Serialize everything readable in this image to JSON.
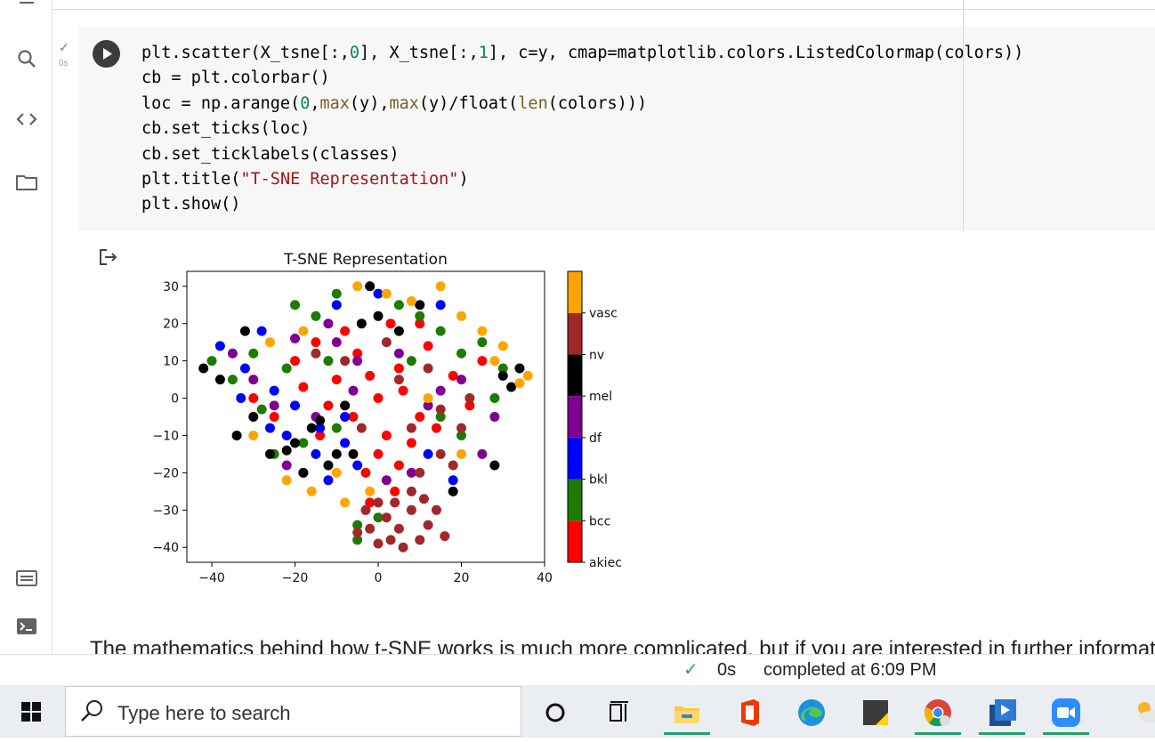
{
  "cell": {
    "run_time": "0s",
    "code_lines": [
      [
        {
          "t": "plt.scatter(X_tsne[:,"
        },
        {
          "t": "0",
          "c": "num"
        },
        {
          "t": "], X_tsne[:,"
        },
        {
          "t": "1",
          "c": "num"
        },
        {
          "t": "], c=y, cmap=matplotlib.colors.ListedColormap(colors))"
        }
      ],
      [
        {
          "t": "cb = plt.colorbar()"
        }
      ],
      [
        {
          "t": "loc = np.arange("
        },
        {
          "t": "0",
          "c": "num"
        },
        {
          "t": ","
        },
        {
          "t": "max",
          "c": "fn"
        },
        {
          "t": "(y),"
        },
        {
          "t": "max",
          "c": "fn"
        },
        {
          "t": "(y)/float("
        },
        {
          "t": "len",
          "c": "fn"
        },
        {
          "t": "(colors)))"
        }
      ],
      [
        {
          "t": "cb.set_ticks(loc)"
        }
      ],
      [
        {
          "t": "cb.set_ticklabels(classes)"
        }
      ],
      [
        {
          "t": "plt.title("
        },
        {
          "t": "\"T-SNE Representation\"",
          "c": "str"
        },
        {
          "t": ")"
        }
      ],
      [
        {
          "t": "plt.show()"
        }
      ]
    ]
  },
  "chart_data": {
    "type": "scatter",
    "title": "T-SNE Representation",
    "xlabel": "",
    "ylabel": "",
    "xlim": [
      -46,
      40
    ],
    "ylim": [
      -44,
      34
    ],
    "x_ticks": [
      -40,
      -20,
      0,
      20,
      40
    ],
    "y_ticks": [
      30,
      20,
      10,
      0,
      -10,
      -20,
      -30,
      -40
    ],
    "colorbar": {
      "classes": [
        "akiec",
        "bcc",
        "bkl",
        "df",
        "mel",
        "nv",
        "vasc"
      ],
      "colors": [
        "#ff0000",
        "#1e7b00",
        "#0000ff",
        "#7f0090",
        "#000000",
        "#a0282a",
        "#ffa500"
      ]
    },
    "series": [
      {
        "class": "akiec",
        "points": [
          [
            -20,
            10
          ],
          [
            -15,
            15
          ],
          [
            -10,
            5
          ],
          [
            -5,
            12
          ],
          [
            0,
            0
          ],
          [
            5,
            8
          ],
          [
            10,
            -5
          ],
          [
            2,
            -10
          ],
          [
            0,
            -15
          ],
          [
            -3,
            -20
          ],
          [
            5,
            -18
          ],
          [
            8,
            -12
          ],
          [
            -12,
            -2
          ],
          [
            -18,
            3
          ],
          [
            -8,
            18
          ],
          [
            3,
            20
          ],
          [
            12,
            14
          ],
          [
            18,
            6
          ],
          [
            22,
            -2
          ],
          [
            -25,
            -5
          ],
          [
            -30,
            0
          ],
          [
            -14,
            -10
          ],
          [
            6,
            2
          ],
          [
            -2,
            6
          ],
          [
            14,
            -8
          ],
          [
            25,
            10
          ],
          [
            -6,
            -5
          ],
          [
            4,
            -25
          ],
          [
            -2,
            -28
          ],
          [
            10,
            20
          ]
        ]
      },
      {
        "class": "bcc",
        "points": [
          [
            -40,
            10
          ],
          [
            -35,
            5
          ],
          [
            -30,
            12
          ],
          [
            -28,
            -3
          ],
          [
            -20,
            25
          ],
          [
            -15,
            22
          ],
          [
            -10,
            28
          ],
          [
            5,
            25
          ],
          [
            10,
            22
          ],
          [
            15,
            18
          ],
          [
            20,
            12
          ],
          [
            25,
            15
          ],
          [
            30,
            8
          ],
          [
            -25,
            -15
          ],
          [
            -18,
            -12
          ],
          [
            -10,
            -8
          ],
          [
            0,
            -32
          ],
          [
            -5,
            -34
          ],
          [
            15,
            -5
          ],
          [
            8,
            10
          ],
          [
            -12,
            10
          ],
          [
            20,
            -10
          ],
          [
            -22,
            8
          ],
          [
            -5,
            -38
          ],
          [
            28,
            0
          ]
        ]
      },
      {
        "class": "bkl",
        "points": [
          [
            -38,
            14
          ],
          [
            -32,
            8
          ],
          [
            -25,
            2
          ],
          [
            -22,
            -10
          ],
          [
            -15,
            -15
          ],
          [
            -8,
            -5
          ],
          [
            -18,
            -20
          ],
          [
            -12,
            -22
          ],
          [
            -5,
            -18
          ],
          [
            -28,
            18
          ],
          [
            -20,
            -2
          ],
          [
            -14,
            -8
          ],
          [
            15,
            25
          ],
          [
            12,
            -15
          ],
          [
            0,
            28
          ],
          [
            -8,
            -12
          ],
          [
            -26,
            -8
          ],
          [
            18,
            -22
          ],
          [
            -33,
            0
          ],
          [
            -10,
            25
          ]
        ]
      },
      {
        "class": "df",
        "points": [
          [
            -35,
            12
          ],
          [
            -25,
            -2
          ],
          [
            -20,
            16
          ],
          [
            -12,
            20
          ],
          [
            -10,
            15
          ],
          [
            -5,
            10
          ],
          [
            5,
            12
          ],
          [
            12,
            -2
          ],
          [
            20,
            5
          ],
          [
            28,
            -5
          ],
          [
            -30,
            5
          ],
          [
            -15,
            -5
          ],
          [
            2,
            -22
          ],
          [
            8,
            -20
          ],
          [
            25,
            -15
          ],
          [
            -6,
            2
          ],
          [
            15,
            2
          ],
          [
            -22,
            -18
          ]
        ]
      },
      {
        "class": "mel",
        "points": [
          [
            -42,
            8
          ],
          [
            -38,
            5
          ],
          [
            -34,
            -10
          ],
          [
            -30,
            -5
          ],
          [
            -26,
            -15
          ],
          [
            -20,
            -12
          ],
          [
            -16,
            -8
          ],
          [
            -12,
            -18
          ],
          [
            -8,
            -2
          ],
          [
            -4,
            20
          ],
          [
            -2,
            30
          ],
          [
            0,
            22
          ],
          [
            5,
            18
          ],
          [
            10,
            25
          ],
          [
            30,
            6
          ],
          [
            32,
            3
          ],
          [
            28,
            -18
          ],
          [
            -6,
            -15
          ],
          [
            -22,
            -14
          ],
          [
            -32,
            18
          ],
          [
            -18,
            -20
          ],
          [
            -10,
            -15
          ],
          [
            18,
            -25
          ],
          [
            34,
            8
          ],
          [
            -14,
            -6
          ]
        ]
      },
      {
        "class": "nv",
        "points": [
          [
            0,
            -28
          ],
          [
            2,
            -32
          ],
          [
            5,
            -35
          ],
          [
            8,
            -30
          ],
          [
            10,
            -38
          ],
          [
            -2,
            -35
          ],
          [
            6,
            -40
          ],
          [
            12,
            -34
          ],
          [
            -5,
            -36
          ],
          [
            3,
            -38
          ],
          [
            14,
            -30
          ],
          [
            8,
            -25
          ],
          [
            -3,
            -30
          ],
          [
            11,
            -27
          ],
          [
            4,
            -28
          ],
          [
            0,
            -39
          ],
          [
            10,
            -20
          ],
          [
            15,
            -15
          ],
          [
            20,
            -8
          ],
          [
            18,
            -18
          ],
          [
            -8,
            10
          ],
          [
            5,
            5
          ],
          [
            12,
            8
          ],
          [
            22,
            0
          ],
          [
            -15,
            12
          ],
          [
            2,
            15
          ],
          [
            -4,
            -8
          ],
          [
            15,
            -3
          ],
          [
            8,
            -8
          ],
          [
            16,
            -37
          ]
        ]
      },
      {
        "class": "vasc",
        "points": [
          [
            -5,
            30
          ],
          [
            2,
            28
          ],
          [
            8,
            26
          ],
          [
            15,
            30
          ],
          [
            20,
            22
          ],
          [
            25,
            18
          ],
          [
            30,
            14
          ],
          [
            34,
            4
          ],
          [
            36,
            6
          ],
          [
            -30,
            -10
          ],
          [
            -22,
            -22
          ],
          [
            -16,
            -25
          ],
          [
            -10,
            -20
          ],
          [
            -8,
            -28
          ],
          [
            -2,
            -25
          ],
          [
            -26,
            15
          ],
          [
            -18,
            18
          ],
          [
            12,
            0
          ],
          [
            20,
            -15
          ],
          [
            28,
            10
          ]
        ]
      }
    ]
  },
  "markdown": {
    "text": "The mathematics behind how t-SNE works is much more complicated, but if you are interested in further informat"
  },
  "status": {
    "time": "0s",
    "completed": "completed at 6:09 PM"
  },
  "taskbar": {
    "search_placeholder": "Type here to search"
  }
}
